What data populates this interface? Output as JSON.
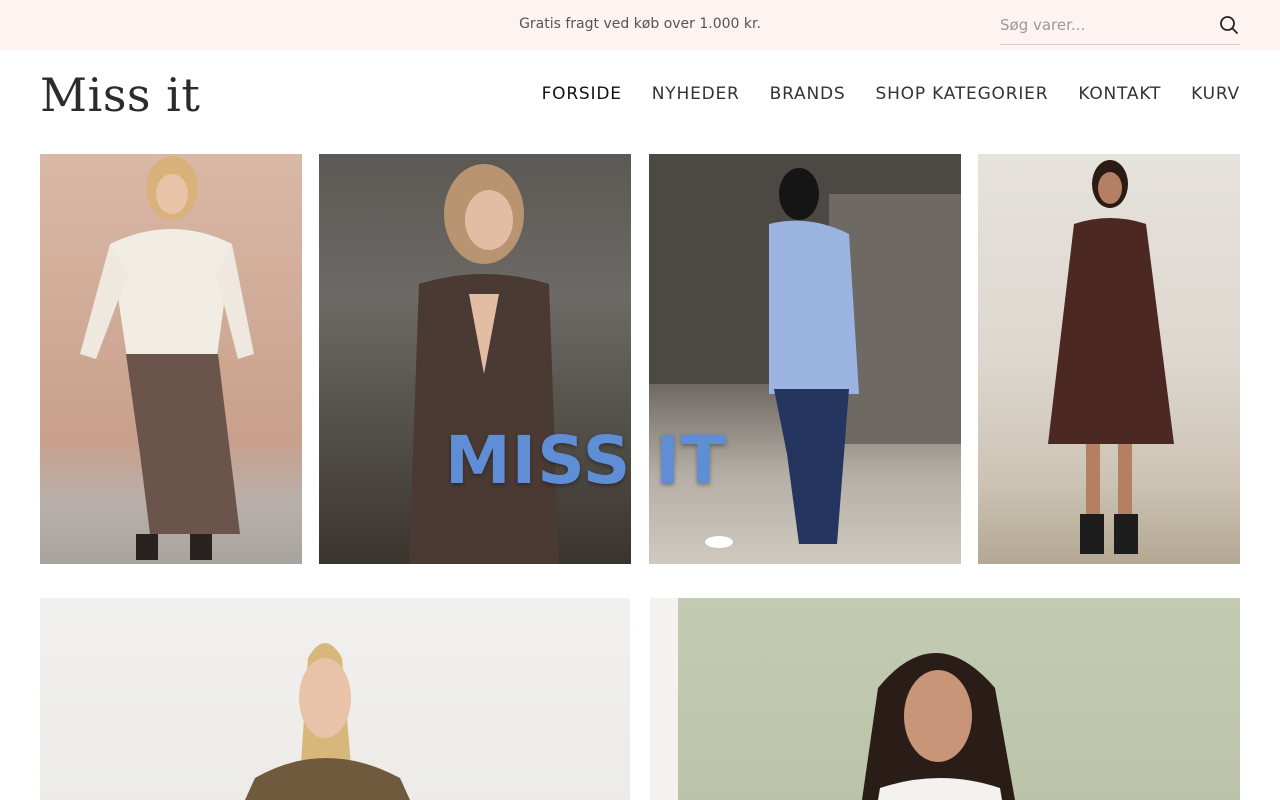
{
  "topbar": {
    "promo_text": "Gratis fragt ved køb over 1.000 kr.",
    "search_placeholder": "Søg varer...",
    "search_icon": "search-icon"
  },
  "header": {
    "logo_text": "Miss it",
    "nav": [
      {
        "label": "FORSIDE",
        "active": true
      },
      {
        "label": "NYHEDER",
        "active": false
      },
      {
        "label": "BRANDS",
        "active": false
      },
      {
        "label": "SHOP KATEGORIER",
        "active": false
      },
      {
        "label": "KONTAKT",
        "active": false
      },
      {
        "label": "KURV",
        "active": false
      }
    ]
  },
  "hero": {
    "overlay_text": "MISS IT"
  },
  "colors": {
    "topbar_bg": "#fdf3f1",
    "overlay_text": "#5f8ed6"
  }
}
